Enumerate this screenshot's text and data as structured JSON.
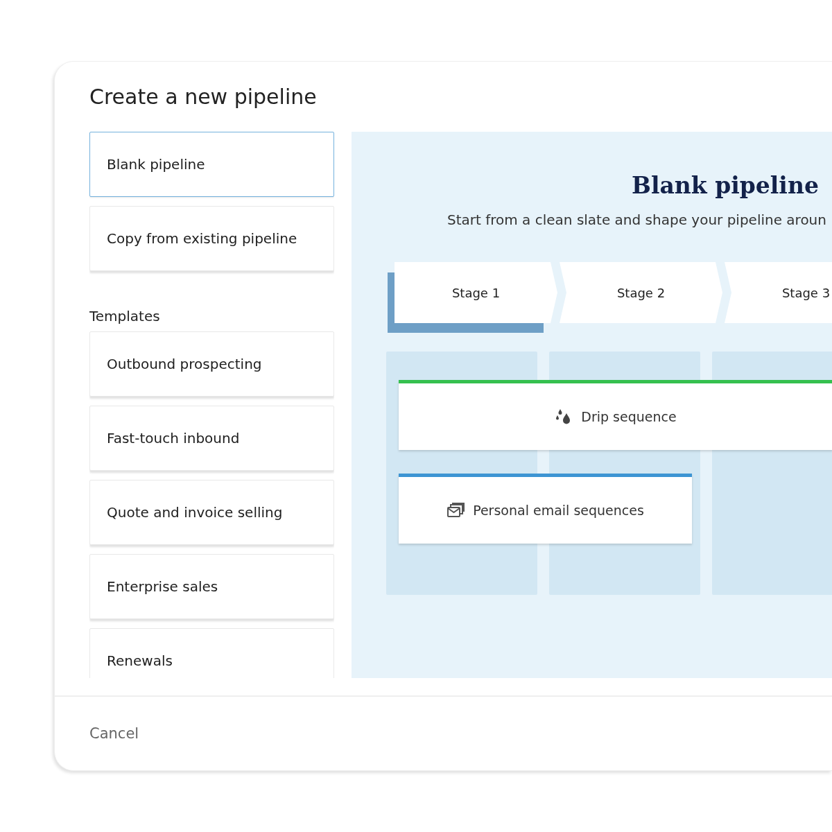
{
  "dialog": {
    "title": "Create a new pipeline"
  },
  "options": [
    {
      "label": "Blank pipeline",
      "selected": true
    },
    {
      "label": "Copy from existing pipeline",
      "selected": false
    }
  ],
  "templates": {
    "heading": "Templates",
    "items": [
      {
        "label": "Outbound prospecting",
        "selected": false
      },
      {
        "label": "Fast-touch inbound",
        "selected": false
      },
      {
        "label": "Quote and invoice selling",
        "selected": false
      },
      {
        "label": "Enterprise sales",
        "selected": false
      },
      {
        "label": "Renewals",
        "selected": false
      }
    ]
  },
  "preview": {
    "title": "Blank pipeline",
    "subtitle": "Start from a clean slate and shape your pipeline aroun",
    "stages": [
      {
        "label": "Stage 1",
        "selected": true
      },
      {
        "label": "Stage 2",
        "selected": false
      },
      {
        "label": "Stage 3",
        "selected": false
      }
    ],
    "cards": [
      {
        "label": "Drip sequence",
        "kind": "drip",
        "color": "#35c04f"
      },
      {
        "label": "Personal email sequences",
        "kind": "email",
        "color": "#3d95d3"
      }
    ]
  },
  "footer": {
    "cancel": "Cancel"
  }
}
